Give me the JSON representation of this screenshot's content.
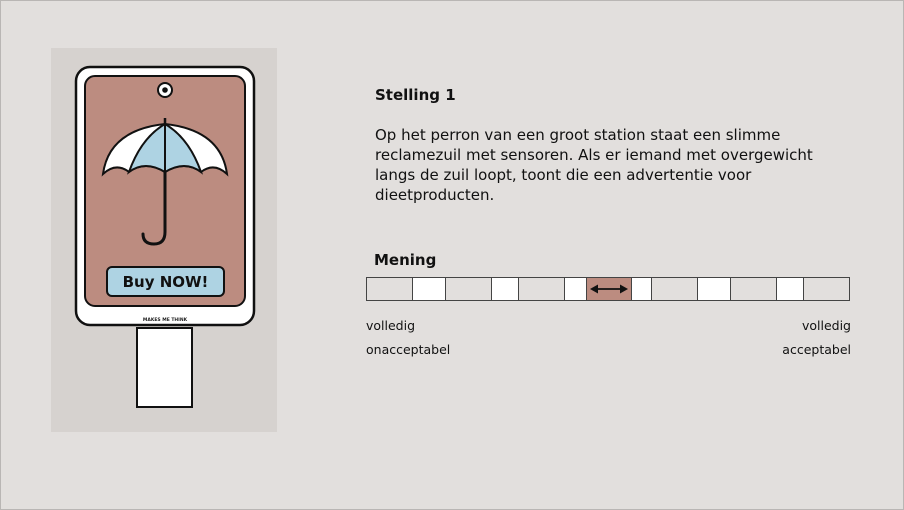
{
  "statement": {
    "title": "Stelling 1",
    "lines": [
      "Op het perron van een groot station staat een slimme",
      "reclamezuil met sensoren. Als er iemand met overgewicht",
      "langs de zuil loopt, toont die een advertentie voor",
      "dieetproducten."
    ]
  },
  "billboard": {
    "button_label": "Buy NOW!",
    "tagline": "MAKES ME THINK",
    "icon": "umbrella-icon",
    "colors": {
      "panel": "#bc8c80",
      "umbrella_light": "#aed3e3",
      "button": "#aed3e3"
    }
  },
  "opinion": {
    "title": "Mening",
    "left_label_line1": "volledig",
    "left_label_line2": "onacceptabel",
    "right_label_line1": "volledig",
    "right_label_line2": "acceptabel",
    "scale_points": 7,
    "selected_index": 3,
    "handle_icon": "double-arrow-icon",
    "selected_color": "#bc8c80"
  }
}
